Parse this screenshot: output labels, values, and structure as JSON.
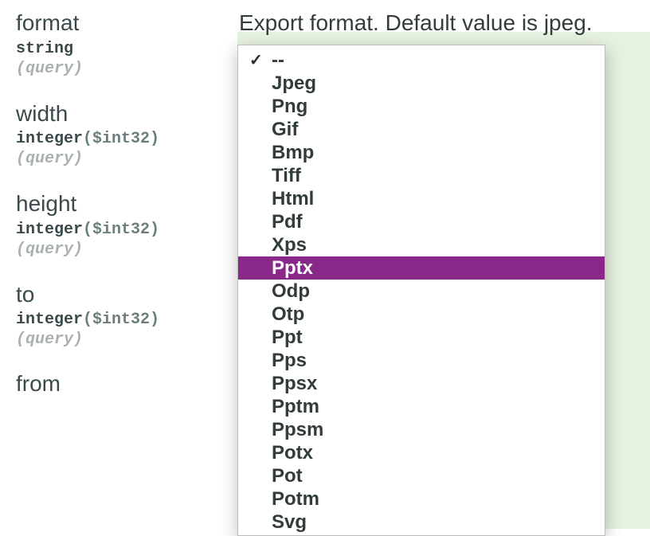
{
  "params": [
    {
      "name": "format",
      "type": "string",
      "typeFormat": "",
      "location": "(query)"
    },
    {
      "name": "width",
      "type": "integer",
      "typeFormat": "($int32)",
      "location": "(query)"
    },
    {
      "name": "height",
      "type": "integer",
      "typeFormat": "($int32)",
      "location": "(query)"
    },
    {
      "name": "to",
      "type": "integer",
      "typeFormat": "($int32)",
      "location": "(query)"
    }
  ],
  "partialParam": "from",
  "description": "Export format. Default value is jpeg.",
  "dropdown": {
    "selectedIndex": 0,
    "highlightedIndex": 9,
    "options": [
      "--",
      "Jpeg",
      "Png",
      "Gif",
      "Bmp",
      "Tiff",
      "Html",
      "Pdf",
      "Xps",
      "Pptx",
      "Odp",
      "Otp",
      "Ppt",
      "Pps",
      "Ppsx",
      "Pptm",
      "Ppsm",
      "Potx",
      "Pot",
      "Potm",
      "Svg"
    ]
  }
}
